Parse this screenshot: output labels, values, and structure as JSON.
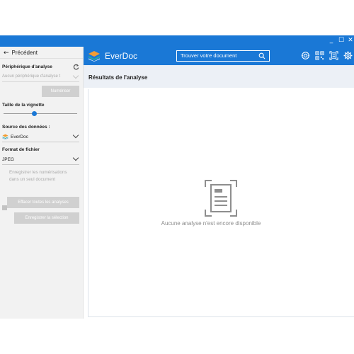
{
  "window": {
    "minimize": "_",
    "maximize": "☐",
    "close": "✕"
  },
  "sidebar": {
    "back_label": "Précédent",
    "scanner_label": "Périphérique d'analyse",
    "scanner_placeholder": "Aucun périphérique d'analyse t",
    "scan_button": "Numériser",
    "thumbnail_label": "Taille de la vignette",
    "thumbnail_size": 0.42,
    "source_label": "Source des données :",
    "source_value": "EverDoc",
    "format_label": "Format de fichier",
    "format_value": "JPEG",
    "save_single_line1": "Enregistrer les numérisations",
    "save_single_line2": "dans un seul document",
    "clear_button": "Effacer toutes les analyses",
    "save_selection_button": "Enregistrer la sélection"
  },
  "header": {
    "app_name": "EverDoc",
    "search_placeholder": "Trouver votre document",
    "icons": [
      "scan-icon",
      "qr-code-icon",
      "document-scan-icon",
      "settings-gear-icon"
    ]
  },
  "main": {
    "results_title": "Résultats de l'analyse",
    "empty_message": "Aucune analyse n'est encore disponible"
  },
  "colors": {
    "accent": "#1a78d6",
    "sidebar_bg": "#f2f2f2",
    "disabled_button": "#d0d0d0",
    "results_bar": "#ecf0f6"
  }
}
